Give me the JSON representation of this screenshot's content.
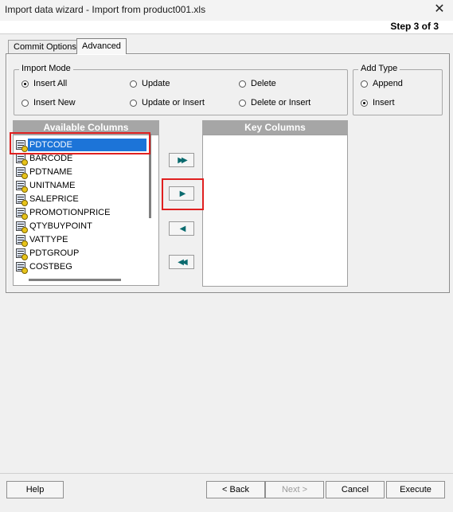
{
  "window": {
    "title": "Import data wizard - Import from product001.xls",
    "step": "Step 3 of 3"
  },
  "tabs": [
    {
      "label": "Commit Options",
      "active": false
    },
    {
      "label": "Advanced",
      "active": true
    }
  ],
  "import_mode": {
    "title": "Import Mode",
    "options": [
      {
        "label": "Insert All",
        "selected": true
      },
      {
        "label": "Update",
        "selected": false
      },
      {
        "label": "Delete",
        "selected": false
      },
      {
        "label": "Insert New",
        "selected": false
      },
      {
        "label": "Update or Insert",
        "selected": false
      },
      {
        "label": "Delete or Insert",
        "selected": false
      }
    ]
  },
  "add_type": {
    "title": "Add Type",
    "options": [
      {
        "label": "Append",
        "selected": false
      },
      {
        "label": "Insert",
        "selected": true
      }
    ]
  },
  "available_columns": {
    "header": "Available Columns",
    "items": [
      "PDTCODE",
      "BARCODE",
      "PDTNAME",
      "UNITNAME",
      "SALEPRICE",
      "PROMOTIONPRICE",
      "QTYBUYPOINT",
      "VATTYPE",
      "PDTGROUP",
      "COSTBEG"
    ],
    "selected": "PDTCODE"
  },
  "key_columns": {
    "header": "Key Columns",
    "items": []
  },
  "move_buttons": [
    {
      "name": "move-all-right",
      "glyph": "▶▶"
    },
    {
      "name": "move-right",
      "glyph": "▶"
    },
    {
      "name": "move-left",
      "glyph": "◀"
    },
    {
      "name": "move-all-left",
      "glyph": "◀◀"
    }
  ],
  "footer": {
    "help": "Help",
    "back": "< Back",
    "next": "Next >",
    "cancel": "Cancel",
    "execute": "Execute"
  },
  "colors": {
    "highlight": "#1c74d8",
    "annotation": "#e02020",
    "arrow": "#0a6a6e"
  }
}
